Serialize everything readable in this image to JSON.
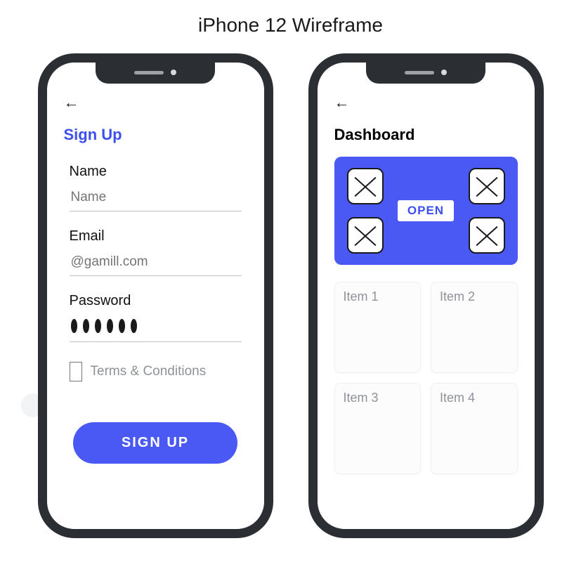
{
  "title": "iPhone 12 Wireframe",
  "signup": {
    "heading": "Sign Up",
    "name_label": "Name",
    "name_placeholder": "Name",
    "email_label": "Email",
    "email_placeholder": "@gamill.com",
    "password_label": "Password",
    "terms_label": "Terms & Conditions",
    "button_label": "SIGN  UP"
  },
  "dashboard": {
    "heading": "Dashboard",
    "open_label": "OPEN",
    "items": [
      {
        "label": "Item 1"
      },
      {
        "label": "Item 2"
      },
      {
        "label": "Item 3"
      },
      {
        "label": "Item 4"
      }
    ]
  },
  "colors": {
    "accent": "#4a59f4",
    "frame": "#2b2f33"
  }
}
